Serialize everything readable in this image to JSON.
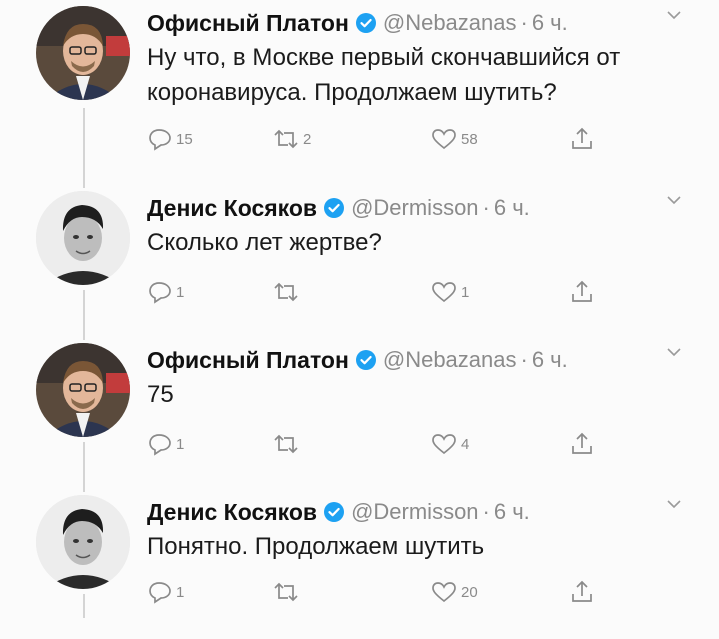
{
  "tweets": [
    {
      "author": "Офисный Платон",
      "handle": "@Nebazanas",
      "time": "6 ч.",
      "text": "Ну что, в Москве первый скончавшийся от коронавируса. Продолжаем шутить?",
      "replies": "15",
      "retweets": "2",
      "likes": "58",
      "avatar": "platon-avatar"
    },
    {
      "author": "Денис Косяков",
      "handle": "@Dermisson",
      "time": "6 ч.",
      "text": "Сколько лет жертве?",
      "replies": "1",
      "retweets": "",
      "likes": "1",
      "avatar": "denis-avatar"
    },
    {
      "author": "Офисный Платон",
      "handle": "@Nebazanas",
      "time": "6 ч.",
      "text": "75",
      "replies": "1",
      "retweets": "",
      "likes": "4",
      "avatar": "platon-avatar"
    },
    {
      "author": "Денис Косяков",
      "handle": "@Dermisson",
      "time": "6 ч.",
      "text": "Понятно. Продолжаем шутить",
      "replies": "1",
      "retweets": "",
      "likes": "20",
      "avatar": "denis-avatar"
    }
  ],
  "separator": "·",
  "colors": {
    "verified_badge": "#1da1f2",
    "secondary_text": "#8a8a8a",
    "thread_line": "#d4d4d4"
  },
  "icons": {
    "reply": "reply-icon",
    "retweet": "retweet-icon",
    "like": "heart-icon",
    "share": "share-icon",
    "verified": "verified-badge-icon",
    "menu": "chevron-down-icon"
  }
}
